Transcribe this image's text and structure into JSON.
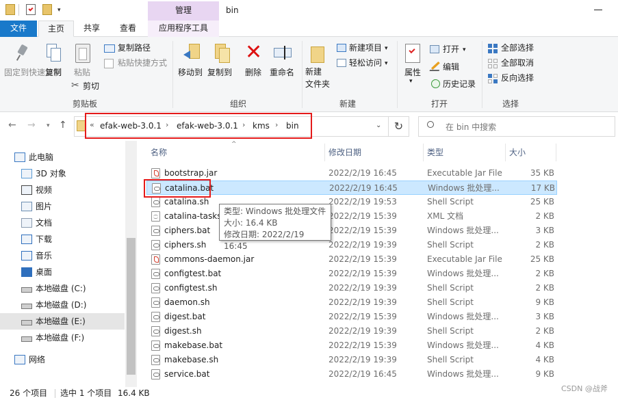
{
  "window": {
    "title": "bin",
    "context_tab": "管理"
  },
  "ribbon_tabs": [
    "文件",
    "主页",
    "共享",
    "查看",
    "应用程序工具"
  ],
  "ribbon": {
    "clipboard": {
      "pin": "固定到快速访问",
      "copy": "复制",
      "paste": "粘贴",
      "copy_path": "复制路径",
      "paste_shortcut": "粘贴快捷方式",
      "cut": "剪切",
      "group": "剪贴板"
    },
    "organize": {
      "move_to": "移动到",
      "copy_to": "复制到",
      "delete": "删除",
      "rename": "重命名",
      "group": "组织"
    },
    "new": {
      "new_folder": "新建\n文件夹",
      "new_item": "新建项目",
      "easy_access": "轻松访问",
      "group": "新建"
    },
    "open": {
      "properties": "属性",
      "open": "打开",
      "edit": "编辑",
      "history": "历史记录",
      "group": "打开"
    },
    "select": {
      "select_all": "全部选择",
      "select_none": "全部取消",
      "invert": "反向选择",
      "group": "选择"
    }
  },
  "address": {
    "prefix": "«",
    "crumbs": [
      "efak-web-3.0.1",
      "efak-web-3.0.1",
      "kms",
      "bin"
    ],
    "separator": "›"
  },
  "search": {
    "placeholder": "在 bin 中搜索"
  },
  "nav": {
    "items": [
      {
        "label": "此电脑",
        "icon": "computer-icon"
      },
      {
        "label": "3D 对象",
        "icon": "3d-objects-icon"
      },
      {
        "label": "视频",
        "icon": "video-icon"
      },
      {
        "label": "图片",
        "icon": "pictures-icon"
      },
      {
        "label": "文档",
        "icon": "documents-icon"
      },
      {
        "label": "下载",
        "icon": "download-icon"
      },
      {
        "label": "音乐",
        "icon": "music-icon"
      },
      {
        "label": "桌面",
        "icon": "desktop-icon"
      },
      {
        "label": "本地磁盘 (C:)",
        "icon": "drive-icon"
      },
      {
        "label": "本地磁盘 (D:)",
        "icon": "drive-icon"
      },
      {
        "label": "本地磁盘 (E:)",
        "icon": "drive-icon"
      },
      {
        "label": "本地磁盘 (F:)",
        "icon": "drive-icon"
      },
      {
        "label": "网络",
        "icon": "network-icon"
      }
    ]
  },
  "columns": {
    "name": "名称",
    "modified": "修改日期",
    "type": "类型",
    "size": "大小"
  },
  "files": [
    {
      "name": "bootstrap.jar",
      "modified": "2022/2/19 16:45",
      "type": "Executable Jar File",
      "size": "35 KB",
      "icon": "jar"
    },
    {
      "name": "catalina.bat",
      "modified": "2022/2/19 16:45",
      "type": "Windows 批处理...",
      "size": "17 KB",
      "icon": "bat"
    },
    {
      "name": "catalina.sh",
      "modified": "2022/2/19 19:53",
      "type": "Shell Script",
      "size": "25 KB",
      "icon": "sh"
    },
    {
      "name": "catalina-tasks.",
      "modified": "2022/2/19 15:39",
      "type": "XML 文档",
      "size": "2 KB",
      "icon": "xml"
    },
    {
      "name": "ciphers.bat",
      "modified": "2022/2/19 15:39",
      "type": "Windows 批处理...",
      "size": "3 KB",
      "icon": "bat"
    },
    {
      "name": "ciphers.sh",
      "modified": "2022/2/19 19:39",
      "type": "Shell Script",
      "size": "2 KB",
      "icon": "sh"
    },
    {
      "name": "commons-daemon.jar",
      "modified": "2022/2/19 15:39",
      "type": "Executable Jar File",
      "size": "25 KB",
      "icon": "jar"
    },
    {
      "name": "configtest.bat",
      "modified": "2022/2/19 15:39",
      "type": "Windows 批处理...",
      "size": "2 KB",
      "icon": "bat"
    },
    {
      "name": "configtest.sh",
      "modified": "2022/2/19 19:39",
      "type": "Shell Script",
      "size": "2 KB",
      "icon": "sh"
    },
    {
      "name": "daemon.sh",
      "modified": "2022/2/19 19:39",
      "type": "Shell Script",
      "size": "9 KB",
      "icon": "sh"
    },
    {
      "name": "digest.bat",
      "modified": "2022/2/19 15:39",
      "type": "Windows 批处理...",
      "size": "3 KB",
      "icon": "bat"
    },
    {
      "name": "digest.sh",
      "modified": "2022/2/19 19:39",
      "type": "Shell Script",
      "size": "2 KB",
      "icon": "sh"
    },
    {
      "name": "makebase.bat",
      "modified": "2022/2/19 15:39",
      "type": "Windows 批处理...",
      "size": "4 KB",
      "icon": "bat"
    },
    {
      "name": "makebase.sh",
      "modified": "2022/2/19 19:39",
      "type": "Shell Script",
      "size": "4 KB",
      "icon": "sh"
    },
    {
      "name": "service.bat",
      "modified": "2022/2/19 16:45",
      "type": "Windows 批处理...",
      "size": "9 KB",
      "icon": "bat"
    }
  ],
  "tooltip": {
    "type": "类型: Windows 批处理文件",
    "size": "大小: 16.4 KB",
    "modified": "修改日期: 2022/2/19 16:45"
  },
  "status": {
    "count": "26 个项目",
    "selected": "选中 1 个项目",
    "sel_size": "16.4 KB"
  },
  "watermark": "CSDN @战斧",
  "colors": {
    "file_tab": "#1979ca",
    "context_tab": "#e8d6f2",
    "selection": "#cce8ff",
    "highlight_box": "#e41a1a"
  }
}
